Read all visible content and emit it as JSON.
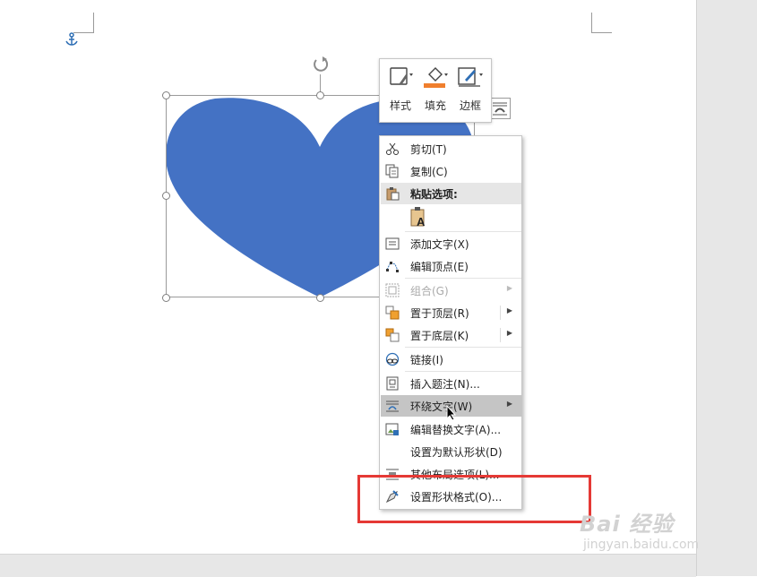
{
  "mini_toolbar": {
    "style_label": "样式",
    "fill_label": "填充",
    "border_label": "边框",
    "fill_color": "#f07f2d"
  },
  "shape": {
    "fill_color": "#4472c4"
  },
  "context_menu": {
    "items": [
      {
        "label": "剪切(T)",
        "icon": "scissors-icon"
      },
      {
        "label": "复制(C)",
        "icon": "copy-icon"
      },
      {
        "label": "粘贴选项:",
        "icon": "paste-icon"
      },
      {
        "label": "添加文字(X)",
        "icon": "add-text-icon"
      },
      {
        "label": "编辑顶点(E)",
        "icon": "edit-points-icon"
      },
      {
        "label": "组合(G)",
        "icon": "group-icon"
      },
      {
        "label": "置于顶层(R)",
        "icon": "bring-to-front-icon"
      },
      {
        "label": "置于底层(K)",
        "icon": "send-to-back-icon"
      },
      {
        "label": "链接(I)",
        "icon": "link-icon"
      },
      {
        "label": "插入题注(N)...",
        "icon": "insert-caption-icon"
      },
      {
        "label": "环绕文字(W)",
        "icon": "wrap-text-icon"
      },
      {
        "label": "编辑替换文字(A)...",
        "icon": "alt-text-icon"
      },
      {
        "label": "设置为默认形状(D)",
        "icon": ""
      },
      {
        "label": "其他布局选项(L)...",
        "icon": "layout-options-icon"
      },
      {
        "label": "设置形状格式(O)...",
        "icon": "format-shape-icon"
      }
    ]
  },
  "highlight_color": "#e53935",
  "watermark": {
    "logo": "Bai 经验",
    "url": "jingyan.baidu.com"
  }
}
